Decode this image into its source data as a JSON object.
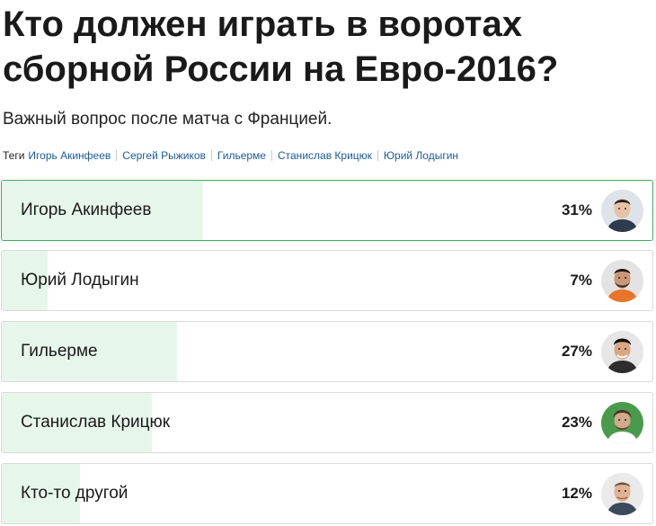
{
  "article": {
    "title": "Кто должен играть в воротах сборной России на Евро-2016?",
    "subtitle": "Важный вопрос после матча с Францией."
  },
  "tags": {
    "label": "Теги",
    "items": [
      "Игорь Акинфеев",
      "Сергей Рыжиков",
      "Гильерме",
      "Станислав Крицюк",
      "Юрий Лодыгин"
    ]
  },
  "poll": {
    "options": [
      {
        "label": "Игорь Акинфеев",
        "percent_text": "31%",
        "percent": 31,
        "selected": true,
        "avatar_icon": "player-photo-akinfeev"
      },
      {
        "label": "Юрий Лодыгин",
        "percent_text": "7%",
        "percent": 7,
        "selected": false,
        "avatar_icon": "player-photo-lodygin"
      },
      {
        "label": "Гильерме",
        "percent_text": "27%",
        "percent": 27,
        "selected": false,
        "avatar_icon": "player-photo-guilherme"
      },
      {
        "label": "Станислав Крицюк",
        "percent_text": "23%",
        "percent": 23,
        "selected": false,
        "avatar_icon": "player-photo-kritsyuk"
      },
      {
        "label": "Кто-то другой",
        "percent_text": "12%",
        "percent": 12,
        "selected": false,
        "avatar_icon": "player-photo-other"
      }
    ]
  },
  "colors": {
    "accent_border": "#3fae5c",
    "bar_fill": "#e7f6ea",
    "tag_link": "#1c5a99"
  }
}
